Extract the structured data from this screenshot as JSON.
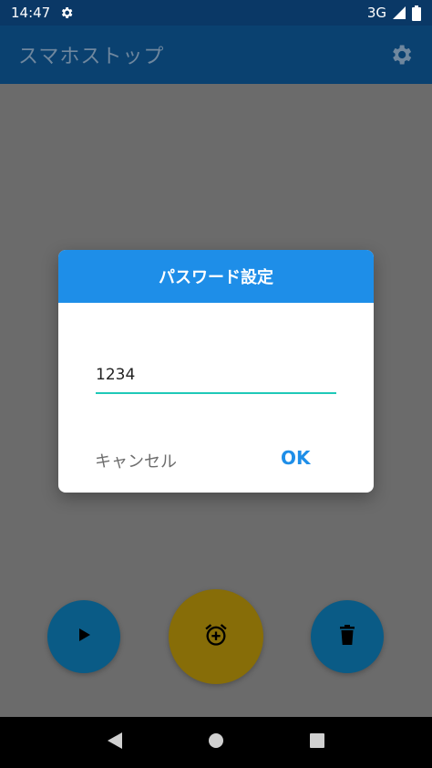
{
  "status_bar": {
    "time": "14:47",
    "network": "3G",
    "icons": [
      "settings-icon",
      "signal-icon",
      "battery-icon"
    ]
  },
  "app_bar": {
    "title": "スマホストップ",
    "settings_icon": "gear-icon"
  },
  "dialog": {
    "title": "パスワード設定",
    "password_value": "1234",
    "cancel_label": "キャンセル",
    "ok_label": "OK"
  },
  "fabs": [
    {
      "name": "play",
      "icon": "play-icon"
    },
    {
      "name": "add-alarm",
      "icon": "alarm-add-icon"
    },
    {
      "name": "delete",
      "icon": "trash-icon"
    }
  ],
  "nav_bar": {
    "icons": [
      "back-icon",
      "home-icon",
      "recents-icon"
    ]
  },
  "colors": {
    "dialog_header": "#1e8ee8",
    "input_underline": "#1fc9b8",
    "ok_text": "#1e8ee8",
    "scrim_background": "#6b6b6b"
  }
}
